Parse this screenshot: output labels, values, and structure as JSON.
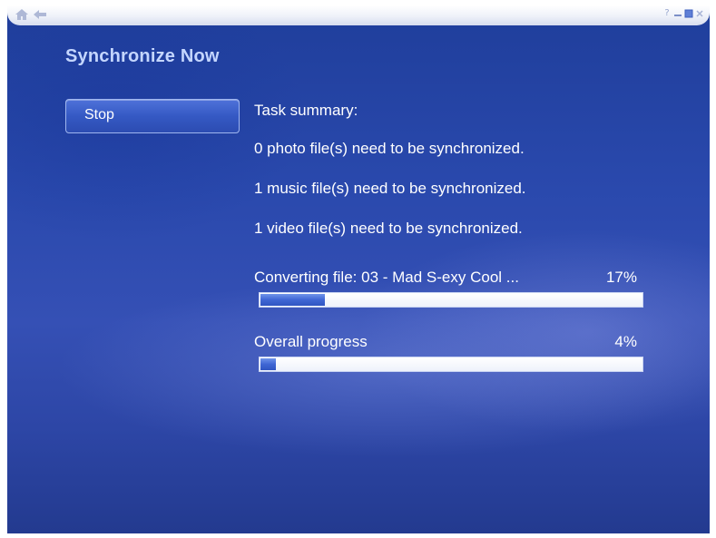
{
  "titlebar": {
    "home_icon": "home-icon",
    "back_icon": "back-arrow-icon",
    "help_icon": "help-icon",
    "minimize_icon": "minimize-icon",
    "maximize_icon": "maximize-icon",
    "close_icon": "close-icon"
  },
  "page": {
    "title": "Synchronize Now"
  },
  "actions": {
    "stop_label": "Stop"
  },
  "summary": {
    "heading": "Task summary:",
    "lines": [
      "0 photo file(s) need to be synchronized.",
      "1 music file(s) need to be synchronized.",
      "1 video file(s) need to be synchronized."
    ]
  },
  "progress": {
    "current": {
      "label": "Converting file: 03 - Mad S-exy Cool ...",
      "percent_text": "17%",
      "fraction": 0.17
    },
    "overall": {
      "label": "Overall progress",
      "percent_text": "4%",
      "fraction": 0.04
    }
  },
  "colors": {
    "background": "#2a49ad",
    "title_text": "#c4d6ff",
    "progress_fill": "#3f66d4",
    "progress_track": "#ffffff"
  }
}
